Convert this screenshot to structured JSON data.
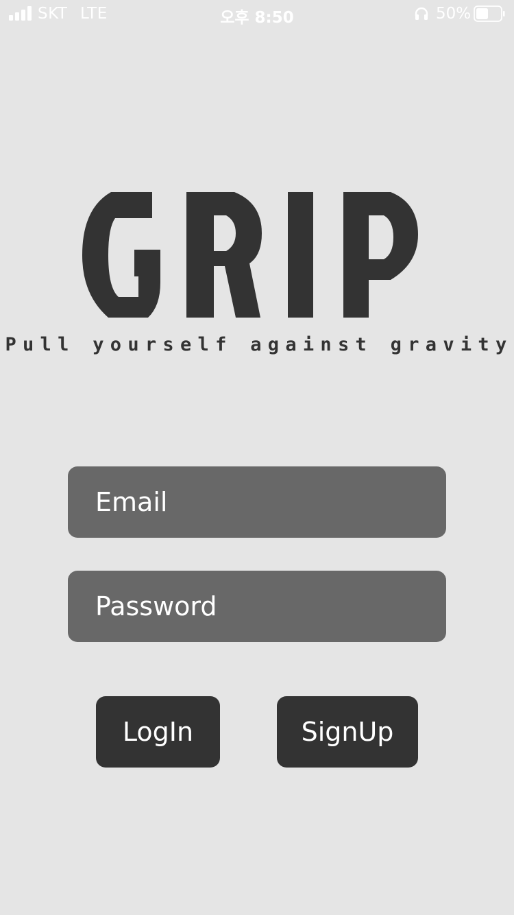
{
  "status_bar": {
    "carrier": "SKT",
    "network": "LTE",
    "time": "오후 8:50",
    "battery_percent": "50%",
    "battery_level": 0.5,
    "signal_icon": "signal-bars-icon",
    "headphone_icon": "headphones-icon",
    "battery_icon": "battery-icon"
  },
  "logo": {
    "wordmark": "GRIP",
    "tagline": "Pull yourself against gravity"
  },
  "form": {
    "email_placeholder": "Email",
    "email_value": "",
    "password_placeholder": "Password",
    "password_value": ""
  },
  "buttons": {
    "login_label": "LogIn",
    "signup_label": "SignUp"
  },
  "colors": {
    "background": "#e5e5e5",
    "primary_dark": "#333333",
    "input_fill": "#686868",
    "text_on_dark": "#ffffff"
  }
}
